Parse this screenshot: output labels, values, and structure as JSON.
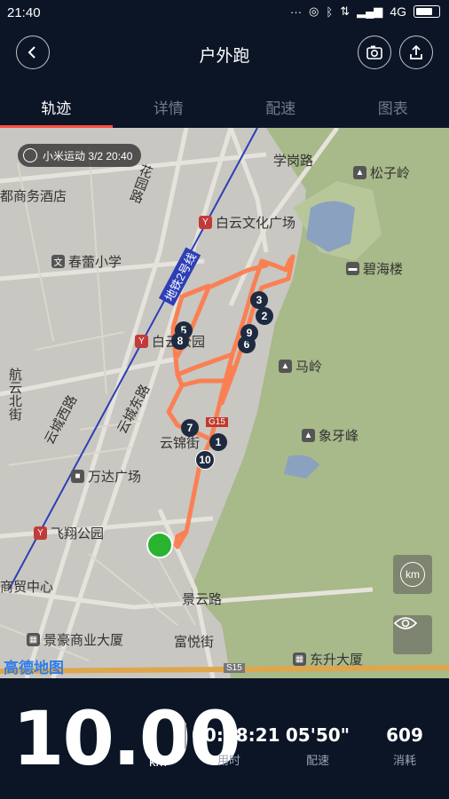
{
  "status": {
    "time": "21:40",
    "network": "4G"
  },
  "header": {
    "title": "户外跑",
    "back_icon": "back-icon",
    "camera_icon": "camera-icon",
    "share_icon": "share-icon"
  },
  "tabs": [
    {
      "label": "轨迹",
      "active": true
    },
    {
      "label": "详情",
      "active": false
    },
    {
      "label": "配速",
      "active": false
    },
    {
      "label": "图表",
      "active": false
    }
  ],
  "map": {
    "watermark": "小米运动 3/2 20:40",
    "provider": "高德地图",
    "roads": [
      "学岗路",
      "花园路",
      "地铁2号线",
      "云城西路",
      "云城东路",
      "航云北街",
      "云锦街",
      "景云路",
      "S15"
    ],
    "pois": [
      "松子岭",
      "都商务酒店",
      "白云文化广场",
      "春蕾小学",
      "碧海楼",
      "白云公园",
      "马岭",
      "象牙峰",
      "万达广场",
      "飞翔公园",
      "商贸中心",
      "景豪商业大厦",
      "富悦街",
      "东升大厦",
      "G15"
    ],
    "markers": [
      "1",
      "2",
      "3",
      "5",
      "6",
      "7",
      "8",
      "9",
      "10"
    ],
    "btn_km": "km"
  },
  "stats": {
    "distance": "10.00",
    "distance_unit": "km",
    "duration": "00:58:21",
    "duration_label": "用时",
    "pace": "05'50\"",
    "pace_label": "配速",
    "calories": "609",
    "calories_label": "消耗"
  },
  "colors": {
    "track": "#ff7a4a",
    "tab_indicator": "#ff4b3e",
    "bg": "#0b1526",
    "start": "#29b32f"
  }
}
